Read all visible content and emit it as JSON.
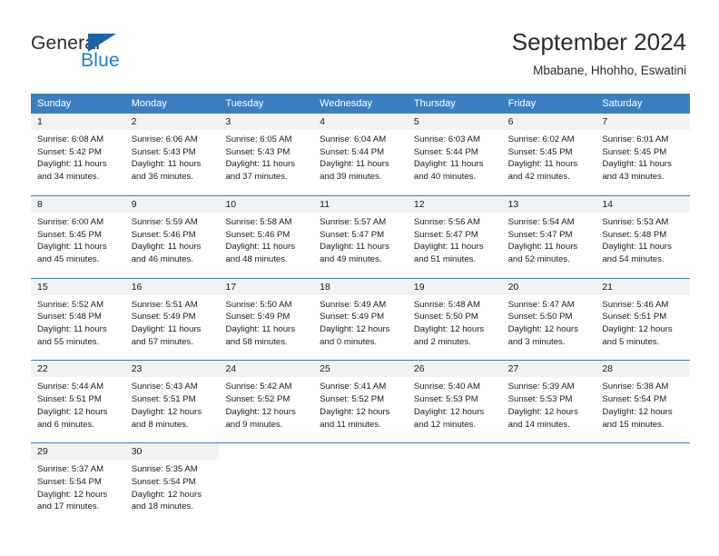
{
  "brand": {
    "name_part1": "General",
    "name_part2": "Blue",
    "triangle_color": "#1b63a8",
    "blue_text_color": "#1f7ec4"
  },
  "header": {
    "title": "September 2024",
    "subtitle": "Mbabane, Hhohho, Eswatini"
  },
  "theme": {
    "header_blue": "#3a7fc1",
    "day_number_bg": "#f2f2f2",
    "text": "#1a1a1a"
  },
  "weekdays": [
    "Sunday",
    "Monday",
    "Tuesday",
    "Wednesday",
    "Thursday",
    "Friday",
    "Saturday"
  ],
  "weeks": [
    [
      {
        "day": "1",
        "sunrise": "Sunrise: 6:08 AM",
        "sunset": "Sunset: 5:42 PM",
        "daylight_line1": "Daylight: 11 hours",
        "daylight_line2": "and 34 minutes."
      },
      {
        "day": "2",
        "sunrise": "Sunrise: 6:06 AM",
        "sunset": "Sunset: 5:43 PM",
        "daylight_line1": "Daylight: 11 hours",
        "daylight_line2": "and 36 minutes."
      },
      {
        "day": "3",
        "sunrise": "Sunrise: 6:05 AM",
        "sunset": "Sunset: 5:43 PM",
        "daylight_line1": "Daylight: 11 hours",
        "daylight_line2": "and 37 minutes."
      },
      {
        "day": "4",
        "sunrise": "Sunrise: 6:04 AM",
        "sunset": "Sunset: 5:44 PM",
        "daylight_line1": "Daylight: 11 hours",
        "daylight_line2": "and 39 minutes."
      },
      {
        "day": "5",
        "sunrise": "Sunrise: 6:03 AM",
        "sunset": "Sunset: 5:44 PM",
        "daylight_line1": "Daylight: 11 hours",
        "daylight_line2": "and 40 minutes."
      },
      {
        "day": "6",
        "sunrise": "Sunrise: 6:02 AM",
        "sunset": "Sunset: 5:45 PM",
        "daylight_line1": "Daylight: 11 hours",
        "daylight_line2": "and 42 minutes."
      },
      {
        "day": "7",
        "sunrise": "Sunrise: 6:01 AM",
        "sunset": "Sunset: 5:45 PM",
        "daylight_line1": "Daylight: 11 hours",
        "daylight_line2": "and 43 minutes."
      }
    ],
    [
      {
        "day": "8",
        "sunrise": "Sunrise: 6:00 AM",
        "sunset": "Sunset: 5:45 PM",
        "daylight_line1": "Daylight: 11 hours",
        "daylight_line2": "and 45 minutes."
      },
      {
        "day": "9",
        "sunrise": "Sunrise: 5:59 AM",
        "sunset": "Sunset: 5:46 PM",
        "daylight_line1": "Daylight: 11 hours",
        "daylight_line2": "and 46 minutes."
      },
      {
        "day": "10",
        "sunrise": "Sunrise: 5:58 AM",
        "sunset": "Sunset: 5:46 PM",
        "daylight_line1": "Daylight: 11 hours",
        "daylight_line2": "and 48 minutes."
      },
      {
        "day": "11",
        "sunrise": "Sunrise: 5:57 AM",
        "sunset": "Sunset: 5:47 PM",
        "daylight_line1": "Daylight: 11 hours",
        "daylight_line2": "and 49 minutes."
      },
      {
        "day": "12",
        "sunrise": "Sunrise: 5:56 AM",
        "sunset": "Sunset: 5:47 PM",
        "daylight_line1": "Daylight: 11 hours",
        "daylight_line2": "and 51 minutes."
      },
      {
        "day": "13",
        "sunrise": "Sunrise: 5:54 AM",
        "sunset": "Sunset: 5:47 PM",
        "daylight_line1": "Daylight: 11 hours",
        "daylight_line2": "and 52 minutes."
      },
      {
        "day": "14",
        "sunrise": "Sunrise: 5:53 AM",
        "sunset": "Sunset: 5:48 PM",
        "daylight_line1": "Daylight: 11 hours",
        "daylight_line2": "and 54 minutes."
      }
    ],
    [
      {
        "day": "15",
        "sunrise": "Sunrise: 5:52 AM",
        "sunset": "Sunset: 5:48 PM",
        "daylight_line1": "Daylight: 11 hours",
        "daylight_line2": "and 55 minutes."
      },
      {
        "day": "16",
        "sunrise": "Sunrise: 5:51 AM",
        "sunset": "Sunset: 5:49 PM",
        "daylight_line1": "Daylight: 11 hours",
        "daylight_line2": "and 57 minutes."
      },
      {
        "day": "17",
        "sunrise": "Sunrise: 5:50 AM",
        "sunset": "Sunset: 5:49 PM",
        "daylight_line1": "Daylight: 11 hours",
        "daylight_line2": "and 58 minutes."
      },
      {
        "day": "18",
        "sunrise": "Sunrise: 5:49 AM",
        "sunset": "Sunset: 5:49 PM",
        "daylight_line1": "Daylight: 12 hours",
        "daylight_line2": "and 0 minutes."
      },
      {
        "day": "19",
        "sunrise": "Sunrise: 5:48 AM",
        "sunset": "Sunset: 5:50 PM",
        "daylight_line1": "Daylight: 12 hours",
        "daylight_line2": "and 2 minutes."
      },
      {
        "day": "20",
        "sunrise": "Sunrise: 5:47 AM",
        "sunset": "Sunset: 5:50 PM",
        "daylight_line1": "Daylight: 12 hours",
        "daylight_line2": "and 3 minutes."
      },
      {
        "day": "21",
        "sunrise": "Sunrise: 5:46 AM",
        "sunset": "Sunset: 5:51 PM",
        "daylight_line1": "Daylight: 12 hours",
        "daylight_line2": "and 5 minutes."
      }
    ],
    [
      {
        "day": "22",
        "sunrise": "Sunrise: 5:44 AM",
        "sunset": "Sunset: 5:51 PM",
        "daylight_line1": "Daylight: 12 hours",
        "daylight_line2": "and 6 minutes."
      },
      {
        "day": "23",
        "sunrise": "Sunrise: 5:43 AM",
        "sunset": "Sunset: 5:51 PM",
        "daylight_line1": "Daylight: 12 hours",
        "daylight_line2": "and 8 minutes."
      },
      {
        "day": "24",
        "sunrise": "Sunrise: 5:42 AM",
        "sunset": "Sunset: 5:52 PM",
        "daylight_line1": "Daylight: 12 hours",
        "daylight_line2": "and 9 minutes."
      },
      {
        "day": "25",
        "sunrise": "Sunrise: 5:41 AM",
        "sunset": "Sunset: 5:52 PM",
        "daylight_line1": "Daylight: 12 hours",
        "daylight_line2": "and 11 minutes."
      },
      {
        "day": "26",
        "sunrise": "Sunrise: 5:40 AM",
        "sunset": "Sunset: 5:53 PM",
        "daylight_line1": "Daylight: 12 hours",
        "daylight_line2": "and 12 minutes."
      },
      {
        "day": "27",
        "sunrise": "Sunrise: 5:39 AM",
        "sunset": "Sunset: 5:53 PM",
        "daylight_line1": "Daylight: 12 hours",
        "daylight_line2": "and 14 minutes."
      },
      {
        "day": "28",
        "sunrise": "Sunrise: 5:38 AM",
        "sunset": "Sunset: 5:54 PM",
        "daylight_line1": "Daylight: 12 hours",
        "daylight_line2": "and 15 minutes."
      }
    ],
    [
      {
        "day": "29",
        "sunrise": "Sunrise: 5:37 AM",
        "sunset": "Sunset: 5:54 PM",
        "daylight_line1": "Daylight: 12 hours",
        "daylight_line2": "and 17 minutes."
      },
      {
        "day": "30",
        "sunrise": "Sunrise: 5:35 AM",
        "sunset": "Sunset: 5:54 PM",
        "daylight_line1": "Daylight: 12 hours",
        "daylight_line2": "and 18 minutes."
      },
      {
        "day": "",
        "sunrise": "",
        "sunset": "",
        "daylight_line1": "",
        "daylight_line2": "",
        "blank": true
      },
      {
        "day": "",
        "sunrise": "",
        "sunset": "",
        "daylight_line1": "",
        "daylight_line2": "",
        "blank": true
      },
      {
        "day": "",
        "sunrise": "",
        "sunset": "",
        "daylight_line1": "",
        "daylight_line2": "",
        "blank": true
      },
      {
        "day": "",
        "sunrise": "",
        "sunset": "",
        "daylight_line1": "",
        "daylight_line2": "",
        "blank": true
      },
      {
        "day": "",
        "sunrise": "",
        "sunset": "",
        "daylight_line1": "",
        "daylight_line2": "",
        "blank": true
      }
    ]
  ]
}
